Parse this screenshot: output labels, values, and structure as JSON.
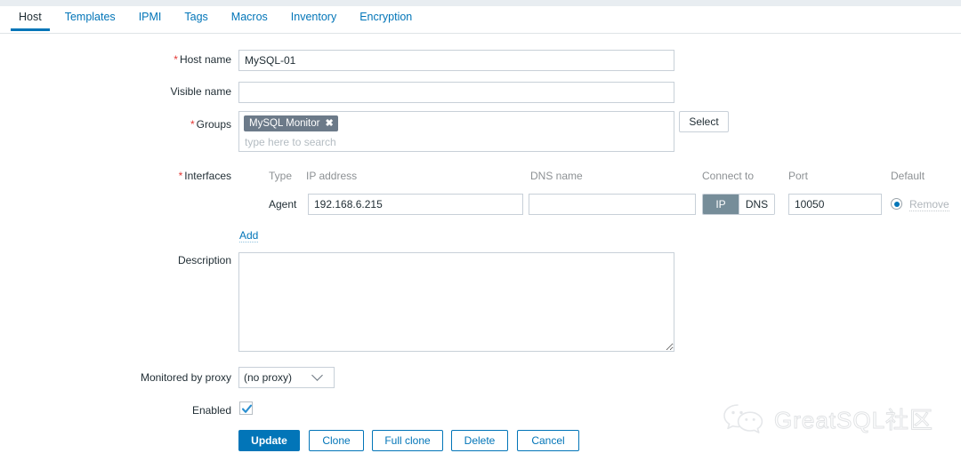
{
  "tabs": [
    {
      "label": "Host",
      "active": true
    },
    {
      "label": "Templates",
      "active": false
    },
    {
      "label": "IPMI",
      "active": false
    },
    {
      "label": "Tags",
      "active": false
    },
    {
      "label": "Macros",
      "active": false
    },
    {
      "label": "Inventory",
      "active": false
    },
    {
      "label": "Encryption",
      "active": false
    }
  ],
  "form": {
    "host_name": {
      "label": "Host name",
      "required": true,
      "value": "MySQL-01"
    },
    "visible_name": {
      "label": "Visible name",
      "required": false,
      "value": "",
      "placeholder": ""
    },
    "groups": {
      "label": "Groups",
      "required": true,
      "chips": [
        "MySQL Monitor"
      ],
      "chip_remove_glyph": "✖",
      "placeholder": "type here to search",
      "select_button": "Select"
    },
    "interfaces": {
      "label": "Interfaces",
      "required": true,
      "headers": [
        "Type",
        "IP address",
        "DNS name",
        "Connect to",
        "Port",
        "Default"
      ],
      "rows": [
        {
          "type": "Agent",
          "ip": "192.168.6.215",
          "dns": "",
          "connect_to": {
            "options": [
              "IP",
              "DNS"
            ],
            "selected": "IP"
          },
          "port": "10050",
          "default_selected": true,
          "remove_label": "Remove"
        }
      ],
      "add_link": "Add"
    },
    "description": {
      "label": "Description",
      "value": "",
      "placeholder": ""
    },
    "monitored_by_proxy": {
      "label": "Monitored by proxy",
      "value": "(no proxy)",
      "options": [
        "(no proxy)"
      ]
    },
    "enabled": {
      "label": "Enabled",
      "checked": true
    }
  },
  "buttons": [
    {
      "label": "Update",
      "primary": true
    },
    {
      "label": "Clone",
      "primary": false
    },
    {
      "label": "Full clone",
      "primary": false
    },
    {
      "label": "Delete",
      "primary": false
    },
    {
      "label": "Cancel",
      "primary": false
    }
  ],
  "watermark": {
    "text": "GreatSQL社区",
    "icon": "wechat-logo-icon"
  },
  "colors": {
    "accent": "#0275b8",
    "required": "#e33734",
    "chip_bg": "#6c7a89",
    "toggle_on_bg": "#768d99",
    "border": "#c8d0d8",
    "header_text": "#8d9194"
  }
}
